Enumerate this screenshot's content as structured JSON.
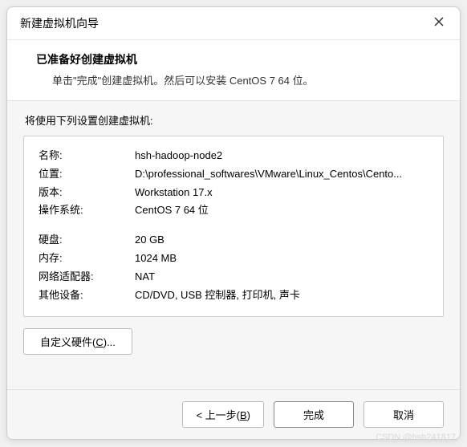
{
  "titlebar": {
    "title": "新建虚拟机向导"
  },
  "header": {
    "title": "已准备好创建虚拟机",
    "subtitle": "单击\"完成\"创建虚拟机。然后可以安装 CentOS 7 64 位。"
  },
  "content": {
    "intro": "将使用下列设置创建虚拟机:",
    "rows": [
      {
        "label": "名称:",
        "value": "hsh-hadoop-node2"
      },
      {
        "label": "位置:",
        "value": "D:\\professional_softwares\\VMware\\Linux_Centos\\Cento..."
      },
      {
        "label": "版本:",
        "value": "Workstation 17.x"
      },
      {
        "label": "操作系统:",
        "value": "CentOS 7 64 位"
      }
    ],
    "rows2": [
      {
        "label": "硬盘:",
        "value": "20 GB"
      },
      {
        "label": "内存:",
        "value": "1024 MB"
      },
      {
        "label": "网络适配器:",
        "value": "NAT"
      },
      {
        "label": "其他设备:",
        "value": "CD/DVD, USB 控制器, 打印机, 声卡"
      }
    ],
    "customize_prefix": "自定义硬件(",
    "customize_key": "C",
    "customize_suffix": ")..."
  },
  "footer": {
    "back_prefix": "< 上一步(",
    "back_key": "B",
    "back_suffix": ")",
    "finish": "完成",
    "cancel": "取消"
  },
  "watermark": "CSDN @hsh241817"
}
